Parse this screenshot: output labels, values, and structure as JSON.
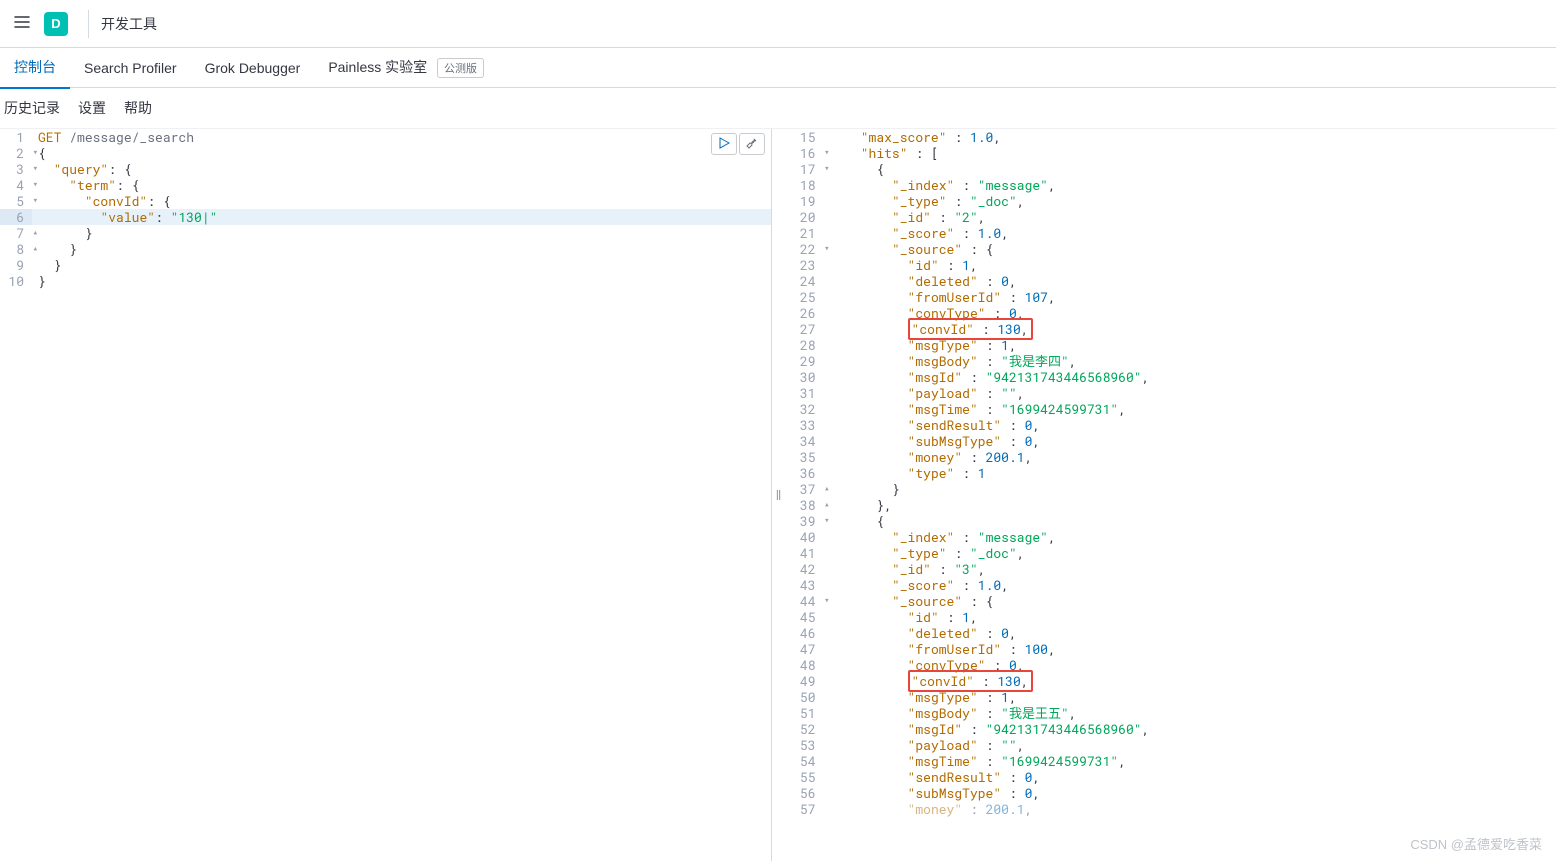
{
  "header": {
    "badge_letter": "D",
    "title": "开发工具"
  },
  "tabs": {
    "console": "控制台",
    "search_profiler": "Search Profiler",
    "grok_debugger": "Grok Debugger",
    "painless_lab": "Painless 实验室",
    "painless_badge": "公测版"
  },
  "toolbar": {
    "history": "历史记录",
    "settings": "设置",
    "help": "帮助"
  },
  "left_editor": {
    "method": "GET",
    "path": "/message/_search",
    "body_lines": [
      {
        "n": 1,
        "type": "request"
      },
      {
        "n": 2,
        "text": "{",
        "indent": 0,
        "fold": "open"
      },
      {
        "n": 3,
        "key": "query",
        "after": ": {",
        "indent": 1,
        "fold": "open"
      },
      {
        "n": 4,
        "key": "term",
        "after": ": {",
        "indent": 2,
        "fold": "open"
      },
      {
        "n": 5,
        "key": "convId",
        "after": ": {",
        "indent": 3,
        "fold": "open"
      },
      {
        "n": 6,
        "key": "value",
        "val_str": "130",
        "indent": 4,
        "highlight": true,
        "cursor": true
      },
      {
        "n": 7,
        "text": "}",
        "indent": 3,
        "fold": "close"
      },
      {
        "n": 8,
        "text": "}",
        "indent": 2,
        "fold": "close"
      },
      {
        "n": 9,
        "text": "}",
        "indent": 1
      },
      {
        "n": 10,
        "text": "}",
        "indent": 0
      }
    ]
  },
  "right_lines": [
    {
      "n": 15,
      "indent": 2,
      "tokens": [
        [
          "key",
          "max_score"
        ],
        [
          "p",
          " : "
        ],
        [
          "num",
          "1.0"
        ],
        [
          "p",
          ","
        ]
      ]
    },
    {
      "n": 16,
      "indent": 2,
      "tokens": [
        [
          "key",
          "hits"
        ],
        [
          "p",
          " : ["
        ]
      ],
      "fold": "open"
    },
    {
      "n": 17,
      "indent": 3,
      "tokens": [
        [
          "p",
          "{"
        ]
      ],
      "fold": "open"
    },
    {
      "n": 18,
      "indent": 4,
      "tokens": [
        [
          "key",
          "_index"
        ],
        [
          "p",
          " : "
        ],
        [
          "str",
          "message"
        ],
        [
          "p",
          ","
        ]
      ]
    },
    {
      "n": 19,
      "indent": 4,
      "tokens": [
        [
          "key",
          "_type"
        ],
        [
          "p",
          " : "
        ],
        [
          "str",
          "_doc"
        ],
        [
          "p",
          ","
        ]
      ]
    },
    {
      "n": 20,
      "indent": 4,
      "tokens": [
        [
          "key",
          "_id"
        ],
        [
          "p",
          " : "
        ],
        [
          "str",
          "2"
        ],
        [
          "p",
          ","
        ]
      ]
    },
    {
      "n": 21,
      "indent": 4,
      "tokens": [
        [
          "key",
          "_score"
        ],
        [
          "p",
          " : "
        ],
        [
          "num",
          "1.0"
        ],
        [
          "p",
          ","
        ]
      ]
    },
    {
      "n": 22,
      "indent": 4,
      "tokens": [
        [
          "key",
          "_source"
        ],
        [
          "p",
          " : {"
        ]
      ],
      "fold": "open"
    },
    {
      "n": 23,
      "indent": 5,
      "tokens": [
        [
          "key",
          "id"
        ],
        [
          "p",
          " : "
        ],
        [
          "num",
          "1"
        ],
        [
          "p",
          ","
        ]
      ]
    },
    {
      "n": 24,
      "indent": 5,
      "tokens": [
        [
          "key",
          "deleted"
        ],
        [
          "p",
          " : "
        ],
        [
          "num",
          "0"
        ],
        [
          "p",
          ","
        ]
      ]
    },
    {
      "n": 25,
      "indent": 5,
      "tokens": [
        [
          "key",
          "fromUserId"
        ],
        [
          "p",
          " : "
        ],
        [
          "num",
          "107"
        ],
        [
          "p",
          ","
        ]
      ]
    },
    {
      "n": 26,
      "indent": 5,
      "tokens": [
        [
          "key",
          "convType"
        ],
        [
          "p",
          " : "
        ],
        [
          "num",
          "0"
        ],
        [
          "p",
          ","
        ]
      ]
    },
    {
      "n": 27,
      "indent": 5,
      "tokens": [
        [
          "key",
          "convId"
        ],
        [
          "p",
          " : "
        ],
        [
          "num",
          "130"
        ],
        [
          "p",
          ","
        ]
      ],
      "redbox": true
    },
    {
      "n": 28,
      "indent": 5,
      "tokens": [
        [
          "key",
          "msgType"
        ],
        [
          "p",
          " : "
        ],
        [
          "num",
          "1"
        ],
        [
          "p",
          ","
        ]
      ]
    },
    {
      "n": 29,
      "indent": 5,
      "tokens": [
        [
          "key",
          "msgBody"
        ],
        [
          "p",
          " : "
        ],
        [
          "str",
          "我是李四"
        ],
        [
          "p",
          ","
        ]
      ]
    },
    {
      "n": 30,
      "indent": 5,
      "tokens": [
        [
          "key",
          "msgId"
        ],
        [
          "p",
          " : "
        ],
        [
          "str",
          "942131743446568960"
        ],
        [
          "p",
          ","
        ]
      ]
    },
    {
      "n": 31,
      "indent": 5,
      "tokens": [
        [
          "key",
          "payload"
        ],
        [
          "p",
          " : "
        ],
        [
          "str",
          ""
        ],
        [
          "p",
          ","
        ]
      ]
    },
    {
      "n": 32,
      "indent": 5,
      "tokens": [
        [
          "key",
          "msgTime"
        ],
        [
          "p",
          " : "
        ],
        [
          "str",
          "1699424599731"
        ],
        [
          "p",
          ","
        ]
      ]
    },
    {
      "n": 33,
      "indent": 5,
      "tokens": [
        [
          "key",
          "sendResult"
        ],
        [
          "p",
          " : "
        ],
        [
          "num",
          "0"
        ],
        [
          "p",
          ","
        ]
      ]
    },
    {
      "n": 34,
      "indent": 5,
      "tokens": [
        [
          "key",
          "subMsgType"
        ],
        [
          "p",
          " : "
        ],
        [
          "num",
          "0"
        ],
        [
          "p",
          ","
        ]
      ]
    },
    {
      "n": 35,
      "indent": 5,
      "tokens": [
        [
          "key",
          "money"
        ],
        [
          "p",
          " : "
        ],
        [
          "num",
          "200.1"
        ],
        [
          "p",
          ","
        ]
      ]
    },
    {
      "n": 36,
      "indent": 5,
      "tokens": [
        [
          "key",
          "type"
        ],
        [
          "p",
          " : "
        ],
        [
          "num",
          "1"
        ]
      ]
    },
    {
      "n": 37,
      "indent": 4,
      "tokens": [
        [
          "p",
          "}"
        ]
      ],
      "fold": "close"
    },
    {
      "n": 38,
      "indent": 3,
      "tokens": [
        [
          "p",
          "},"
        ]
      ],
      "fold": "close"
    },
    {
      "n": 39,
      "indent": 3,
      "tokens": [
        [
          "p",
          "{"
        ]
      ],
      "fold": "open"
    },
    {
      "n": 40,
      "indent": 4,
      "tokens": [
        [
          "key",
          "_index"
        ],
        [
          "p",
          " : "
        ],
        [
          "str",
          "message"
        ],
        [
          "p",
          ","
        ]
      ]
    },
    {
      "n": 41,
      "indent": 4,
      "tokens": [
        [
          "key",
          "_type"
        ],
        [
          "p",
          " : "
        ],
        [
          "str",
          "_doc"
        ],
        [
          "p",
          ","
        ]
      ]
    },
    {
      "n": 42,
      "indent": 4,
      "tokens": [
        [
          "key",
          "_id"
        ],
        [
          "p",
          " : "
        ],
        [
          "str",
          "3"
        ],
        [
          "p",
          ","
        ]
      ]
    },
    {
      "n": 43,
      "indent": 4,
      "tokens": [
        [
          "key",
          "_score"
        ],
        [
          "p",
          " : "
        ],
        [
          "num",
          "1.0"
        ],
        [
          "p",
          ","
        ]
      ]
    },
    {
      "n": 44,
      "indent": 4,
      "tokens": [
        [
          "key",
          "_source"
        ],
        [
          "p",
          " : {"
        ]
      ],
      "fold": "open"
    },
    {
      "n": 45,
      "indent": 5,
      "tokens": [
        [
          "key",
          "id"
        ],
        [
          "p",
          " : "
        ],
        [
          "num",
          "1"
        ],
        [
          "p",
          ","
        ]
      ]
    },
    {
      "n": 46,
      "indent": 5,
      "tokens": [
        [
          "key",
          "deleted"
        ],
        [
          "p",
          " : "
        ],
        [
          "num",
          "0"
        ],
        [
          "p",
          ","
        ]
      ]
    },
    {
      "n": 47,
      "indent": 5,
      "tokens": [
        [
          "key",
          "fromUserId"
        ],
        [
          "p",
          " : "
        ],
        [
          "num",
          "100"
        ],
        [
          "p",
          ","
        ]
      ]
    },
    {
      "n": 48,
      "indent": 5,
      "tokens": [
        [
          "key",
          "convType"
        ],
        [
          "p",
          " : "
        ],
        [
          "num",
          "0"
        ],
        [
          "p",
          ","
        ]
      ]
    },
    {
      "n": 49,
      "indent": 5,
      "tokens": [
        [
          "key",
          "convId"
        ],
        [
          "p",
          " : "
        ],
        [
          "num",
          "130"
        ],
        [
          "p",
          ","
        ]
      ],
      "redbox": true
    },
    {
      "n": 50,
      "indent": 5,
      "tokens": [
        [
          "key",
          "msgType"
        ],
        [
          "p",
          " : "
        ],
        [
          "num",
          "1"
        ],
        [
          "p",
          ","
        ]
      ]
    },
    {
      "n": 51,
      "indent": 5,
      "tokens": [
        [
          "key",
          "msgBody"
        ],
        [
          "p",
          " : "
        ],
        [
          "str",
          "我是王五"
        ],
        [
          "p",
          ","
        ]
      ]
    },
    {
      "n": 52,
      "indent": 5,
      "tokens": [
        [
          "key",
          "msgId"
        ],
        [
          "p",
          " : "
        ],
        [
          "str",
          "942131743446568960"
        ],
        [
          "p",
          ","
        ]
      ]
    },
    {
      "n": 53,
      "indent": 5,
      "tokens": [
        [
          "key",
          "payload"
        ],
        [
          "p",
          " : "
        ],
        [
          "str",
          ""
        ],
        [
          "p",
          ","
        ]
      ]
    },
    {
      "n": 54,
      "indent": 5,
      "tokens": [
        [
          "key",
          "msgTime"
        ],
        [
          "p",
          " : "
        ],
        [
          "str",
          "1699424599731"
        ],
        [
          "p",
          ","
        ]
      ]
    },
    {
      "n": 55,
      "indent": 5,
      "tokens": [
        [
          "key",
          "sendResult"
        ],
        [
          "p",
          " : "
        ],
        [
          "num",
          "0"
        ],
        [
          "p",
          ","
        ]
      ]
    },
    {
      "n": 56,
      "indent": 5,
      "tokens": [
        [
          "key",
          "subMsgType"
        ],
        [
          "p",
          " : "
        ],
        [
          "num",
          "0"
        ],
        [
          "p",
          ","
        ]
      ]
    },
    {
      "n": 57,
      "indent": 5,
      "tokens": [
        [
          "key",
          "money"
        ],
        [
          "p",
          " : "
        ],
        [
          "num",
          "200.1"
        ],
        [
          "p",
          ","
        ]
      ],
      "cut": true
    }
  ],
  "watermark": "CSDN @孟德爱吃香菜"
}
